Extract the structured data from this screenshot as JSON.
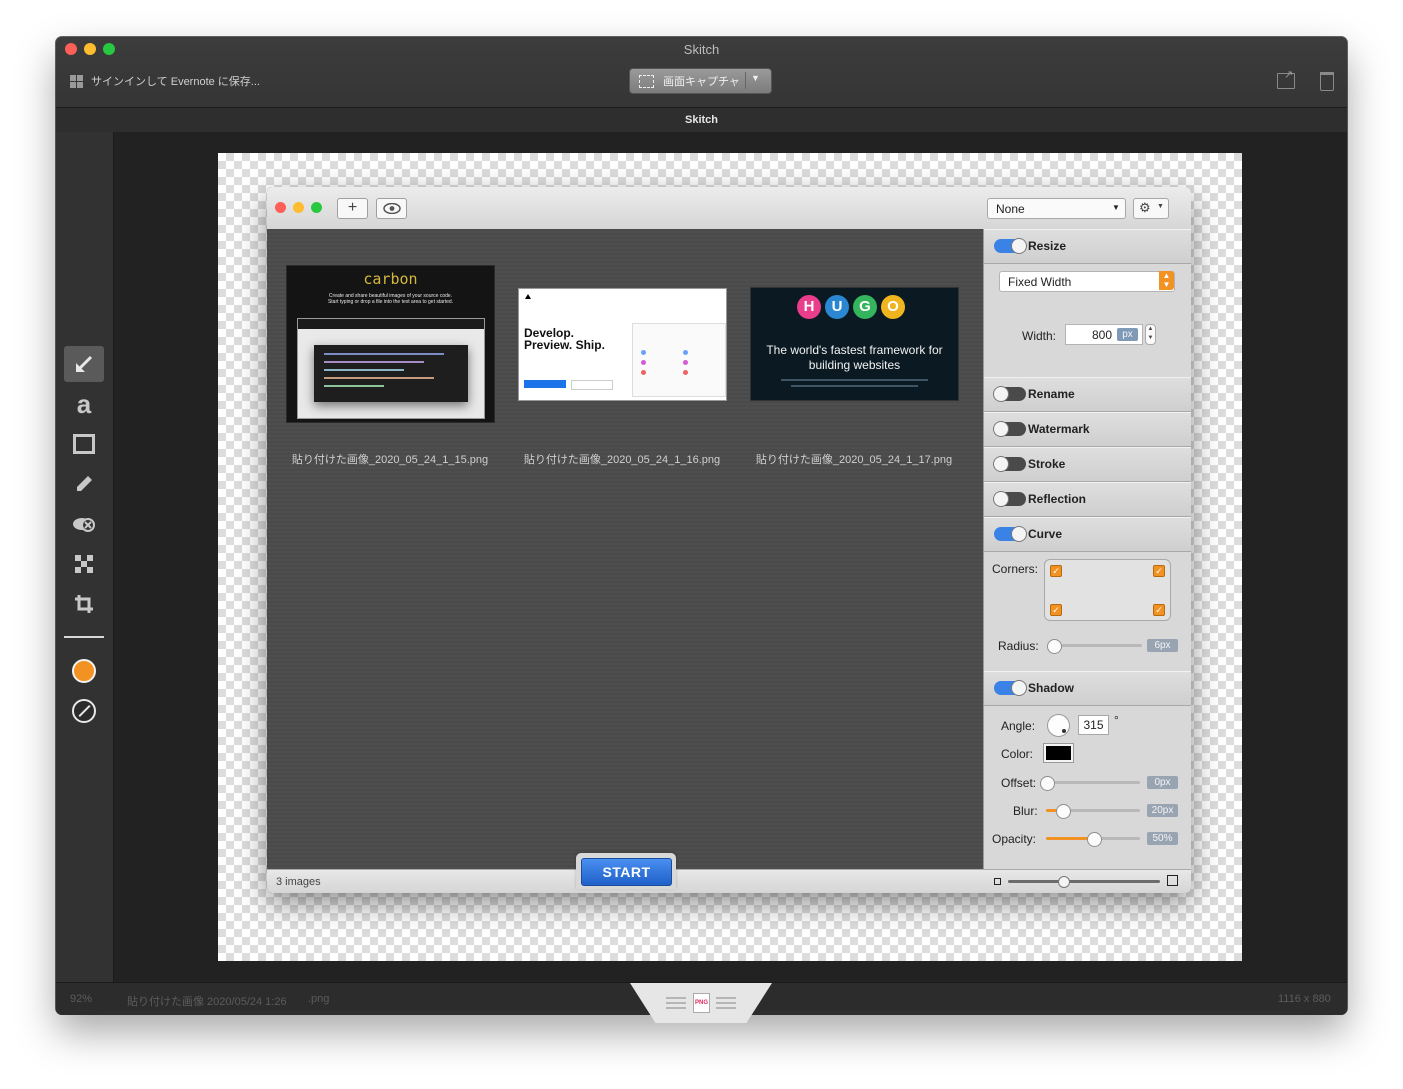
{
  "window": {
    "title": "Skitch",
    "signin_label": "サインインして Evernote に保存...",
    "capture_label": "画面キャプチャ",
    "subtitle": "Skitch"
  },
  "status": {
    "zoom": "92%",
    "filename": "貼り付けた画像 2020/05/24 1:26",
    "format": ".png",
    "format_badge": "PNG",
    "dimensions": "1116 x 880"
  },
  "tools": [
    "arrow-icon",
    "text-icon",
    "rectangle-icon",
    "marker-icon",
    "blur-eye-icon",
    "pixelate-icon",
    "crop-icon"
  ],
  "colors": {
    "accent": "#f29222",
    "toggle_on": "#3b82e6",
    "start": "#2a6fd6"
  },
  "inner": {
    "preset": "None",
    "thumbnails": [
      {
        "label": "貼り付けた画像_2020_05_24_1_15.png",
        "logo": "carbon",
        "caption_1": "Create and share beautiful images of your source code.",
        "caption_2": "Start typing or drop a file into the text area to get started."
      },
      {
        "label": "貼り付けた画像_2020_05_24_1_16.png",
        "headline_1": "Develop.",
        "headline_2": "Preview. Ship."
      },
      {
        "label": "貼り付けた画像_2020_05_24_1_17.png",
        "logo_letters": [
          "H",
          "U",
          "G",
          "O"
        ],
        "tagline_1": "The world's fastest framework for",
        "tagline_2": "building websites"
      }
    ],
    "image_count": "3 images",
    "start_label": "START",
    "sections": {
      "resize": {
        "label": "Resize",
        "mode": "Fixed Width",
        "width_label": "Width:",
        "width_value": "800",
        "unit": "px"
      },
      "rename": {
        "label": "Rename"
      },
      "watermark": {
        "label": "Watermark"
      },
      "stroke": {
        "label": "Stroke"
      },
      "reflection": {
        "label": "Reflection"
      },
      "curve": {
        "label": "Curve",
        "corners_label": "Corners:",
        "radius_label": "Radius:",
        "radius_value": "6px",
        "radius_fraction": 0.05
      },
      "shadow": {
        "label": "Shadow",
        "angle_label": "Angle:",
        "angle_value": "315",
        "degree": "°",
        "color_label": "Color:",
        "offset_label": "Offset:",
        "offset_value": "0px",
        "offset_fraction": 0.0,
        "blur_label": "Blur:",
        "blur_value": "20px",
        "blur_fraction": 0.17,
        "opacity_label": "Opacity:",
        "opacity_value": "50%",
        "opacity_fraction": 0.5
      }
    }
  }
}
